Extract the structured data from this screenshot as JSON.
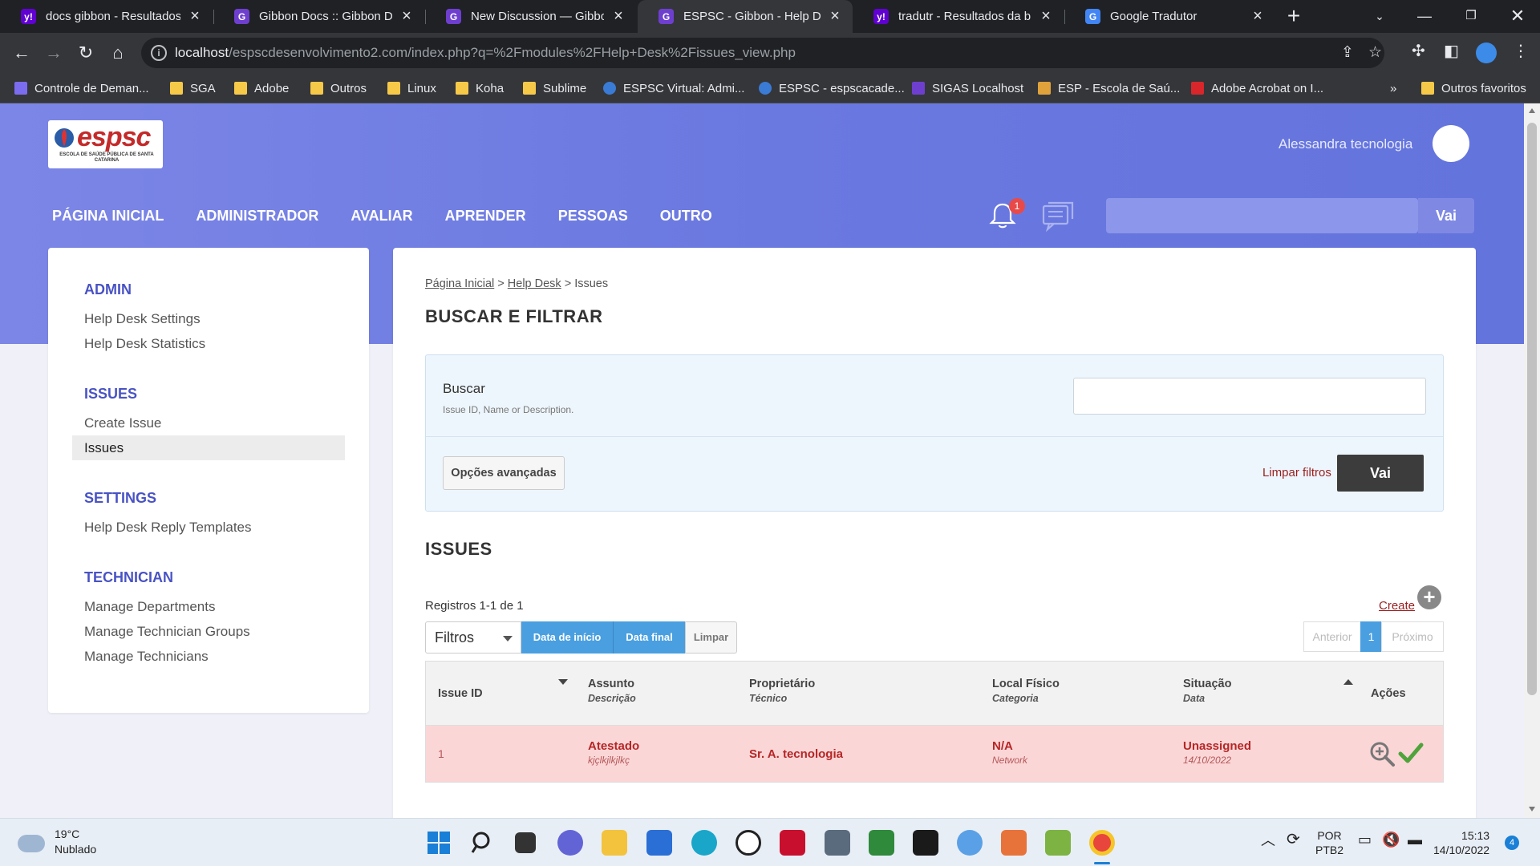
{
  "browser": {
    "tabs": [
      {
        "title": "docs gibbon - Resultados da busca",
        "favicon": "yahoo-icon",
        "color": "#6001d2"
      },
      {
        "title": "Gibbon Docs :: Gibbon Docs",
        "favicon": "gibbon-icon",
        "color": "#6e3fcf"
      },
      {
        "title": "New Discussion — Gibbon",
        "favicon": "gibbon-icon",
        "color": "#6e3fcf"
      },
      {
        "title": "ESPSC - Gibbon - Help Desk",
        "favicon": "gibbon-icon",
        "color": "#6e3fcf"
      },
      {
        "title": "tradutr - Resultados da busca",
        "favicon": "yahoo-icon",
        "color": "#6001d2"
      },
      {
        "title": "Google Tradutor",
        "favicon": "google-translate-icon",
        "color": "#4285f4"
      }
    ],
    "url_host": "localhost",
    "url_path": "/espscdesenvolvimento2.com/index.php?q=%2Fmodules%2FHelp+Desk%2Fissues_view.php",
    "bookmarks": [
      "Controle de Deman...",
      "SGA",
      "Adobe",
      "Outros",
      "Linux",
      "Koha",
      "Sublime",
      "ESPSC Virtual: Admi...",
      "ESPSC - espscacade...",
      "SIGAS Localhost",
      "ESP - Escola de Saú...",
      "Adobe Acrobat on I..."
    ],
    "bookmarks_more": "»",
    "other_bookmarks": "Outros favoritos"
  },
  "header": {
    "logo_text": "espsc",
    "logo_sub": "ESCOLA DE SAÚDE PÚBLICA DE SANTA CATARINA",
    "user_name": "Alessandra tecnologia",
    "nav": [
      "PÁGINA INICIAL",
      "ADMINISTRADOR",
      "AVALIAR",
      "APRENDER",
      "PESSOAS",
      "OUTRO"
    ],
    "notification_count": "1",
    "search_placeholder": "",
    "search_button": "Vai"
  },
  "sidebar": {
    "sections": [
      {
        "heading": "ADMIN",
        "items": [
          "Help Desk Settings",
          "Help Desk Statistics"
        ]
      },
      {
        "heading": "ISSUES",
        "items": [
          "Create Issue",
          "Issues"
        ]
      },
      {
        "heading": "SETTINGS",
        "items": [
          "Help Desk Reply Templates"
        ]
      },
      {
        "heading": "TECHNICIAN",
        "items": [
          "Manage Departments",
          "Manage Technician Groups",
          "Manage Technicians"
        ]
      }
    ],
    "selected": "Issues"
  },
  "main": {
    "breadcrumb": {
      "home": "Página Inicial",
      "module": "Help Desk",
      "current": "Issues",
      "sep": ">"
    },
    "filter_title": "BUSCAR E FILTRAR",
    "search_label": "Buscar",
    "search_hint": "Issue ID, Name or Description.",
    "search_value": "",
    "advanced_button": "Opções avançadas",
    "clear_filters": "Limpar filtros",
    "go_button": "Vai",
    "issues_title": "ISSUES",
    "records": "Registros 1-1 de 1",
    "create_label": "Create",
    "filters_select": "Filtros",
    "filter_buttons": {
      "start": "Data de início",
      "end": "Data final",
      "clear": "Limpar"
    },
    "pager": {
      "prev": "Anterior",
      "page": "1",
      "next": "Próximo"
    },
    "table": {
      "headers": [
        {
          "main": "Issue ID",
          "sub": ""
        },
        {
          "main": "Assunto",
          "sub": "Descrição"
        },
        {
          "main": "Proprietário",
          "sub": "Técnico"
        },
        {
          "main": "Local Físico",
          "sub": "Categoria"
        },
        {
          "main": "Situação",
          "sub": "Data"
        },
        {
          "main": "Ações",
          "sub": ""
        }
      ],
      "rows": [
        {
          "id": "1",
          "subject": "Atestado",
          "description": "kjçlkjlkjlkç",
          "owner": "Sr. A. tecnologia",
          "location": "N/A",
          "category": "Network",
          "status": "Unassigned",
          "date": "14/10/2022"
        }
      ]
    }
  },
  "taskbar": {
    "weather_temp": "19°C",
    "weather_desc": "Nublado",
    "lang": "POR",
    "layout": "PTB2",
    "time": "15:13",
    "date": "14/10/2022",
    "notif_count": "4"
  },
  "colors": {
    "accent": "#6a79e0",
    "sidebar_heading": "#4953c4",
    "row_bg": "#fbd6d7",
    "row_text": "#b52626",
    "filter_blue": "#4a9fe0"
  }
}
